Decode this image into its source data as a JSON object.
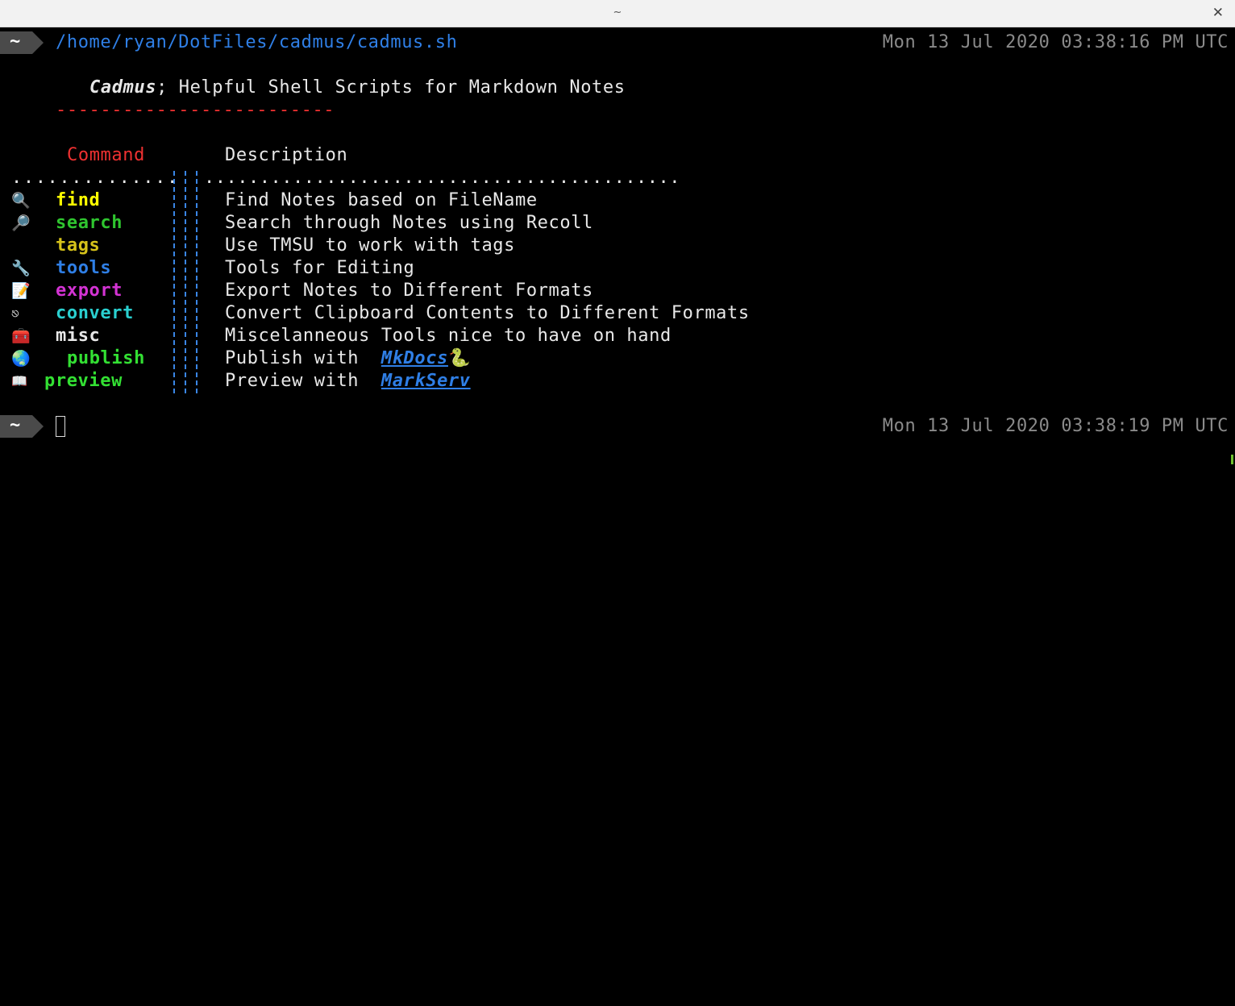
{
  "window": {
    "title": "~",
    "close_glyph": "✕"
  },
  "prompt": {
    "symbol": "~"
  },
  "line1": {
    "path": "/home/ryan/DotFiles/cadmus/cadmus.sh",
    "timestamp": "Mon 13 Jul 2020 03:38:16 PM UTC"
  },
  "heading": {
    "name": "Cadmus",
    "rest": "; Helpful Shell Scripts for Markdown Notes",
    "underline": "-------------------------"
  },
  "table": {
    "col_command": "Command",
    "col_description": "Description",
    "dots_left": "..............",
    "dots_right": "...........................................",
    "rows": [
      {
        "icon": "🔍",
        "icon_name": "magnifier-left-icon",
        "command": "find",
        "color": "#ffff00",
        "description": "Find Notes based on FileName"
      },
      {
        "icon": "🔎",
        "icon_name": "magnifier-right-icon",
        "command": "search",
        "color": "#2fc52f",
        "description": "Search through Notes using Recoll"
      },
      {
        "icon": "🏷",
        "icon_name": "tag-icon",
        "command": "tags",
        "color": "#d6c21a",
        "description": "Use TMSU to work with tags"
      },
      {
        "icon": "🔧",
        "icon_name": "wrench-icon",
        "command": "tools",
        "color": "#2f7fe6",
        "description": "Tools for Editing"
      },
      {
        "icon": "📝",
        "icon_name": "memo-icon",
        "command": "export",
        "color": "#d433d4",
        "description": "Export Notes to Different Formats"
      },
      {
        "icon": "⎋",
        "icon_name": "convert-icon",
        "command": "convert",
        "color": "#2ad0d0",
        "description": "Convert Clipboard Contents to Different Formats"
      },
      {
        "icon": "🧰",
        "icon_name": "toolbox-icon",
        "command": "misc",
        "color": "#e8e8e8",
        "description": "Miscelanneous Tools nice to have on hand"
      },
      {
        "icon": "🌏",
        "icon_name": "globe-icon",
        "command": "publish",
        "color": "#33e033",
        "description": "Publish with ",
        "link": "MkDocs",
        "suffix": "🐍"
      },
      {
        "icon": "📖",
        "icon_name": "book-icon",
        "command": "preview",
        "color": "#33e033",
        "description": "Preview with ",
        "link": "MarkServ",
        "suffix": ""
      }
    ]
  },
  "line2": {
    "timestamp": "Mon 13 Jul 2020 03:38:19 PM UTC"
  }
}
